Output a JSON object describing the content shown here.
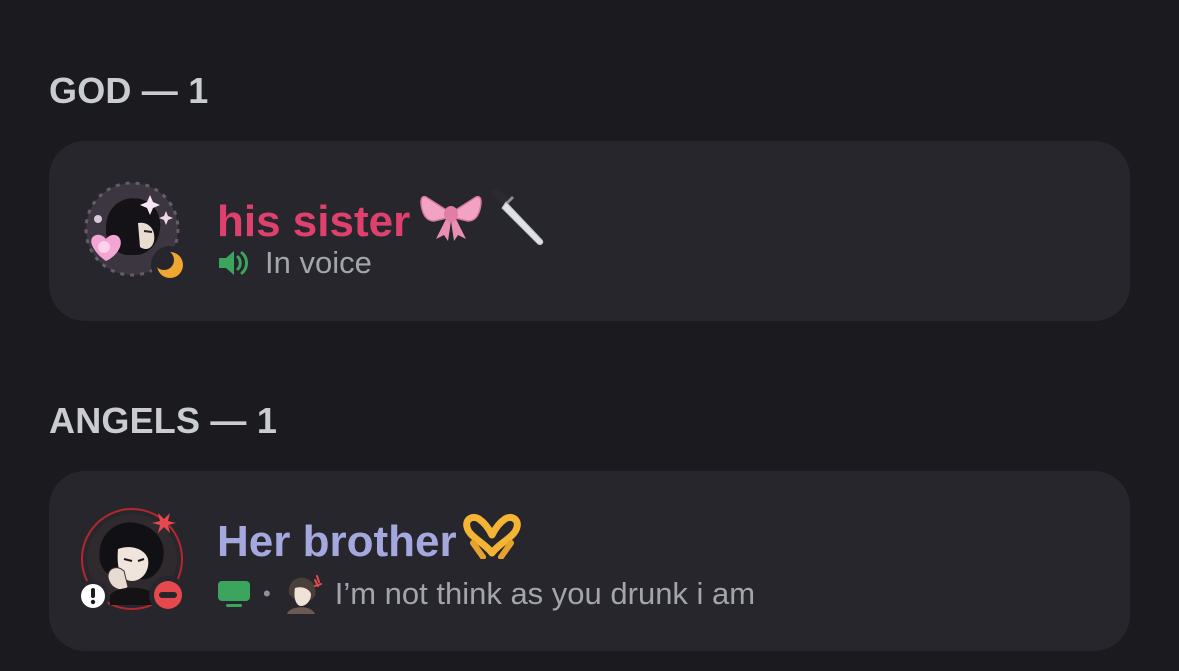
{
  "sections": [
    {
      "header": "GOD — 1",
      "member": {
        "name": "his sister",
        "name_color": "#e0406e",
        "name_emojis": [
          "ribbon-emoji",
          "knife-emoji"
        ],
        "presence": "idle-moon",
        "activity_icon": "speaker-icon",
        "activity_text": "In voice"
      }
    },
    {
      "header": "ANGELS — 1",
      "member": {
        "name": "Her brother",
        "name_color": "#a4a8de",
        "name_emojis": [
          "heart-hands-emoji"
        ],
        "presence": "do-not-disturb",
        "activity_icon": "screen-share-icon",
        "activity_separator": "•",
        "custom_status": "I’m not think as you drunk i am"
      }
    }
  ],
  "colors": {
    "background": "#1b1b1f",
    "card": "#26262c",
    "voice_green": "#3ba55d",
    "dnd_red": "#e5484d",
    "idle_orange": "#f0a732"
  }
}
